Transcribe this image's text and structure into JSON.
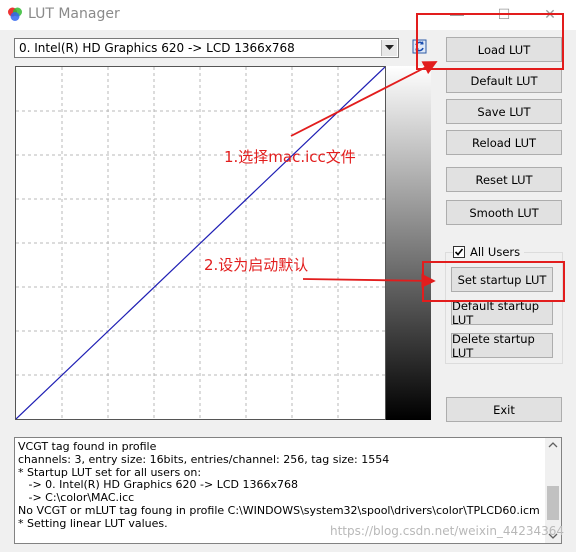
{
  "window": {
    "title": "LUT Manager",
    "minimize": "—",
    "maximize": "☐",
    "close": "✕"
  },
  "display_select": {
    "value": "0. Intel(R) HD Graphics 620 -> LCD 1366x768"
  },
  "buttons": {
    "load": "Load LUT",
    "default": "Default LUT",
    "save": "Save LUT",
    "reload": "Reload LUT",
    "reset": "Reset LUT",
    "smooth": "Smooth LUT",
    "set_startup": "Set startup LUT",
    "default_startup": "Default startup LUT",
    "delete_startup": "Delete startup LUT",
    "exit": "Exit"
  },
  "all_users": {
    "label": "All Users",
    "checked": true
  },
  "log": [
    "VCGT tag found in profile",
    "channels: 3, entry size: 16bits, entries/channel: 256, tag size: 1554",
    "* Startup LUT set for all users on:",
    "   -> 0. Intel(R) HD Graphics 620 -> LCD 1366x768",
    "   -> C:\\color\\MAC.icc",
    "No VCGT or mLUT tag foung in profile C:\\WINDOWS\\system32\\spool\\drivers\\color\\TPLCD60.icm",
    "* Setting linear LUT values."
  ],
  "annotations": {
    "step1": "1.选择mac.icc文件",
    "step2": "2.设为启动默认"
  },
  "watermark": "https://blog.csdn.net/weixin_44234364",
  "colors": {
    "annotation": "#e21d1d",
    "curve": "#1f1fb4",
    "grid": "#b8b8b8"
  }
}
